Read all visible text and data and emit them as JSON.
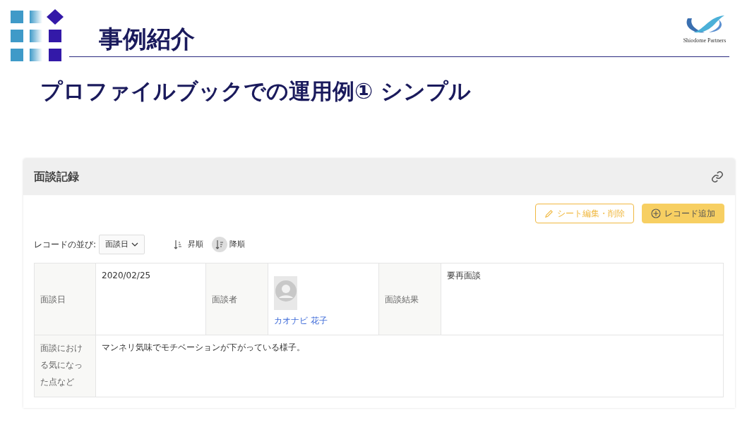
{
  "slide": {
    "title": "事例紹介",
    "subtitle": "プロファイルブックでの運用例① シンプル",
    "logo_text": "Shiodome Partners"
  },
  "panel": {
    "title": "面談記録",
    "buttons": [
      {
        "kind": "outline",
        "label": "シート編集・削除"
      },
      {
        "kind": "filled",
        "label": "レコード追加"
      }
    ],
    "sort": {
      "label": "レコードの並び:",
      "value": "面談日",
      "options": [
        {
          "label": "昇順",
          "selected": false
        },
        {
          "label": "降順",
          "selected": true
        }
      ]
    },
    "table": {
      "rows": [
        {
          "cells": [
            {
              "kind": "label",
              "text": "面談日"
            },
            {
              "kind": "value",
              "text": "2020/02/25"
            },
            {
              "kind": "label",
              "text": "面談者"
            },
            {
              "kind": "person",
              "text": "カオナビ 花子"
            },
            {
              "kind": "label",
              "text": "面談結果"
            },
            {
              "kind": "value",
              "text": "要再面談"
            }
          ]
        },
        {
          "cells": [
            {
              "kind": "label",
              "text": "面談における気になった点など"
            },
            {
              "kind": "value",
              "text": "マンネリ気味でモチベーションが下がっている様子。",
              "colspan": 5
            }
          ]
        }
      ]
    }
  }
}
